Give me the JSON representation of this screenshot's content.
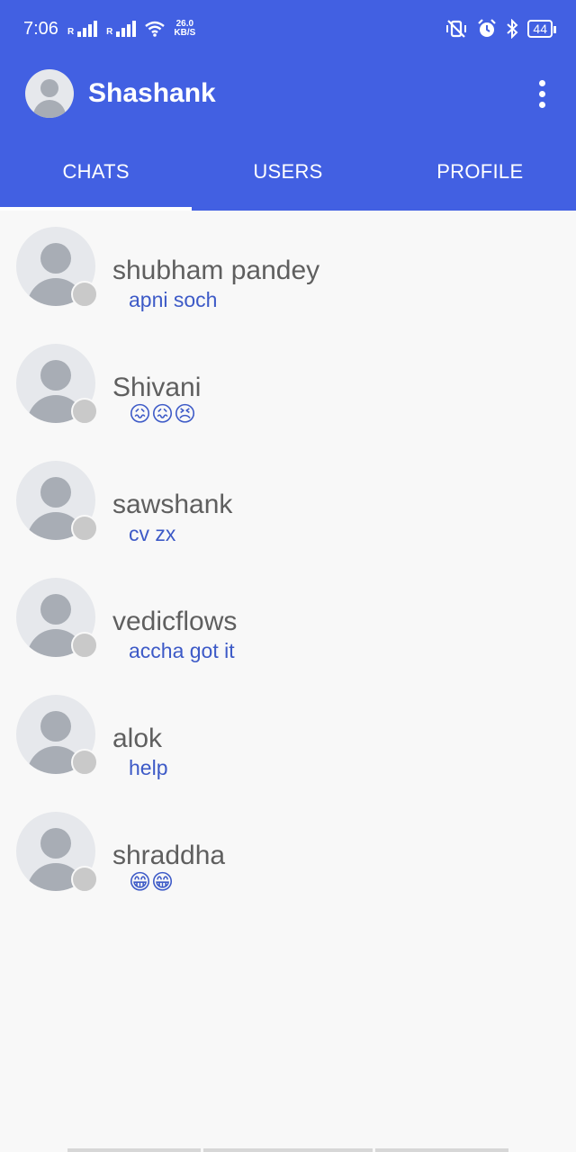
{
  "status_bar": {
    "time": "7:06",
    "net_speed_value": "26.0",
    "net_speed_unit": "KB/S",
    "battery": "44"
  },
  "app_bar": {
    "title": "Shashank",
    "menu_icon": "more-vert-icon"
  },
  "tabs": [
    {
      "label": "CHATS",
      "active": true
    },
    {
      "label": "USERS",
      "active": false
    },
    {
      "label": "PROFILE",
      "active": false
    }
  ],
  "chats": [
    {
      "name": "shubham pandey",
      "message": "apni soch"
    },
    {
      "name": "Shivani",
      "message": "😖😖😣"
    },
    {
      "name": "sawshank",
      "message": "cv zx"
    },
    {
      "name": "vedicflows",
      "message": "accha got it"
    },
    {
      "name": "alok",
      "message": "help"
    },
    {
      "name": "shraddha",
      "message": "😁😁"
    }
  ],
  "colors": {
    "primary": "#4260e2",
    "message_text": "#3d5ac7",
    "name_text": "#5f5f5f",
    "presence_offline": "#c9c9c9"
  }
}
